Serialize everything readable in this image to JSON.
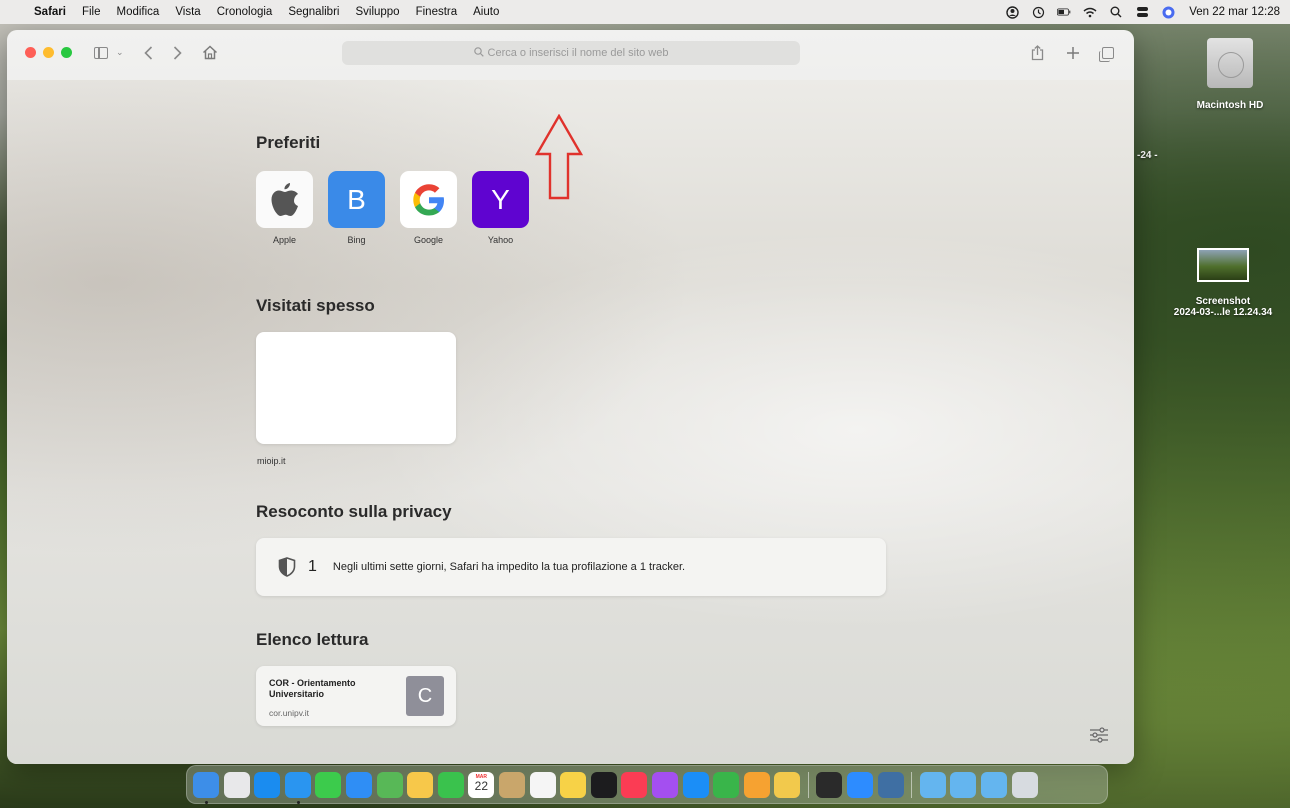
{
  "menubar": {
    "app": "Safari",
    "menus": [
      "File",
      "Modifica",
      "Vista",
      "Cronologia",
      "Segnalibri",
      "Sviluppo",
      "Finestra",
      "Aiuto"
    ],
    "clock": "Ven 22 mar  12:28"
  },
  "toolbar": {
    "address_placeholder": "Cerca o inserisci il nome del sito web"
  },
  "favorites": {
    "title": "Preferiti",
    "items": [
      {
        "label": "Apple",
        "glyph": ""
      },
      {
        "label": "Bing",
        "glyph": "B"
      },
      {
        "label": "Google",
        "glyph": "G"
      },
      {
        "label": "Yahoo",
        "glyph": "Y"
      }
    ]
  },
  "frequently_visited": {
    "title": "Visitati spesso",
    "items": [
      {
        "label": "mioip.it"
      }
    ]
  },
  "privacy": {
    "title": "Resoconto sulla privacy",
    "count": "1",
    "text": "Negli ultimi sette giorni, Safari ha impedito la tua profilazione a 1 tracker."
  },
  "reading_list": {
    "title": "Elenco lettura",
    "items": [
      {
        "title": "COR - Orientamento Universitario",
        "domain": "cor.unipv.it",
        "thumb_letter": "C"
      }
    ]
  },
  "desktop": {
    "items": [
      {
        "label": "Macintosh HD"
      },
      {
        "label_line1": "Screenshot",
        "label_line2": "2024-03-...le 12.24.34"
      }
    ],
    "partial_label": "-24 -"
  },
  "dock": {
    "apps": [
      {
        "name": "finder",
        "color": "#3d8ee8"
      },
      {
        "name": "launchpad",
        "color": "#e8e8ea"
      },
      {
        "name": "app-store",
        "color": "#1a8cf0"
      },
      {
        "name": "safari",
        "color": "#2a95f0"
      },
      {
        "name": "messages",
        "color": "#3ccb4c"
      },
      {
        "name": "mail",
        "color": "#2f8ef5"
      },
      {
        "name": "maps",
        "color": "#58b857"
      },
      {
        "name": "photos",
        "color": "#f7c84a"
      },
      {
        "name": "facetime",
        "color": "#3ac24d"
      },
      {
        "name": "calendar",
        "color": "#ffffff"
      },
      {
        "name": "contacts",
        "color": "#c9a66b"
      },
      {
        "name": "reminders",
        "color": "#f5f5f5"
      },
      {
        "name": "notes",
        "color": "#f7d247"
      },
      {
        "name": "tv",
        "color": "#1c1c1e"
      },
      {
        "name": "music",
        "color": "#fb3c54"
      },
      {
        "name": "podcasts",
        "color": "#a44ff0"
      },
      {
        "name": "keynote",
        "color": "#1b8ef7"
      },
      {
        "name": "numbers",
        "color": "#39b54a"
      },
      {
        "name": "pages",
        "color": "#f6a231"
      },
      {
        "name": "preview",
        "color": "#f2c94c"
      },
      {
        "name": "terminal",
        "color": "#2a2a2a"
      },
      {
        "name": "zoom",
        "color": "#2d8cff"
      },
      {
        "name": "screen-sharing",
        "color": "#3f6fa3"
      },
      {
        "name": "applications-folder",
        "color": "#64b5ef"
      },
      {
        "name": "documents-folder",
        "color": "#64b5ef"
      },
      {
        "name": "downloads-folder",
        "color": "#64b5ef"
      },
      {
        "name": "trash",
        "color": "#d7dbe0"
      }
    ],
    "calendar_day": "22",
    "calendar_month": "MAR"
  },
  "colors": {
    "annotation_arrow": "#e0322c"
  }
}
